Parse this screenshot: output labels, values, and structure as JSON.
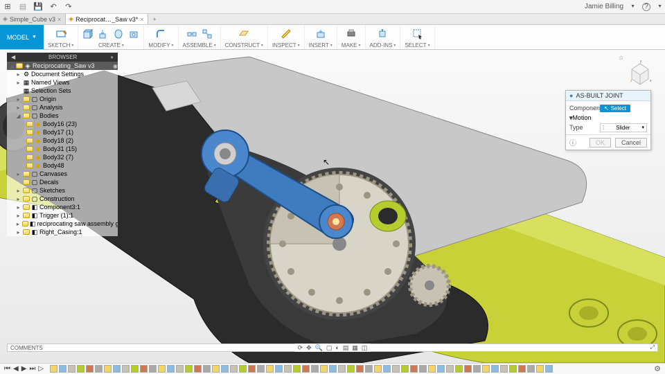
{
  "titlebar": {
    "user": "Jamie Billing",
    "help_icon": "?"
  },
  "doctabs": {
    "tabs": [
      {
        "icon": "◆",
        "label": "Simple_Cube v3",
        "active": false
      },
      {
        "icon": "◆",
        "label": "Reciprocat…_Saw v3*",
        "active": true
      }
    ]
  },
  "ribbon": {
    "model_label": "MODEL",
    "groups": [
      {
        "label": "SKETCH"
      },
      {
        "label": "CREATE"
      },
      {
        "label": "MODIFY"
      },
      {
        "label": "ASSEMBLE"
      },
      {
        "label": "CONSTRUCT"
      },
      {
        "label": "INSPECT"
      },
      {
        "label": "INSERT"
      },
      {
        "label": "MAKE"
      },
      {
        "label": "ADD-INS"
      },
      {
        "label": "SELECT"
      }
    ]
  },
  "browser": {
    "title": "BROWSER",
    "root": "Reciprocating_Saw v3",
    "nodes": [
      {
        "twist": "▸",
        "icon": "⚙",
        "label": "Document Settings"
      },
      {
        "twist": "▸",
        "icon": "▦",
        "label": "Named Views"
      },
      {
        "twist": "",
        "icon": "▦",
        "label": "Selection Sets"
      },
      {
        "twist": "▸",
        "bulb": true,
        "icon": "▢",
        "label": "Origin"
      },
      {
        "twist": "▸",
        "bulb": true,
        "icon": "▢",
        "label": "Analysis"
      },
      {
        "twist": "◢",
        "bulb": true,
        "icon": "▢",
        "label": "Bodies"
      }
    ],
    "bodies": [
      {
        "label": "Body16 (23)"
      },
      {
        "label": "Body17 (1)"
      },
      {
        "label": "Body18 (2)"
      },
      {
        "label": "Body31 (15)"
      },
      {
        "label": "Body32 (7)"
      },
      {
        "label": "Body48"
      }
    ],
    "tail": [
      {
        "twist": "▸",
        "bulb": true,
        "icon": "▢",
        "label": "Canvases"
      },
      {
        "twist": "",
        "bulb": true,
        "icon": "▢",
        "label": "Decals"
      },
      {
        "twist": "▸",
        "bulb": true,
        "icon": "▢",
        "label": "Sketches"
      },
      {
        "twist": "▸",
        "bulb": true,
        "icon": "▢",
        "label": "Construction"
      },
      {
        "twist": "▸",
        "bulb": true,
        "icon": "◧",
        "label": "Component3:1"
      },
      {
        "twist": "▸",
        "bulb": true,
        "icon": "◧",
        "label": "Trigger (1):1"
      },
      {
        "twist": "▸",
        "bulb": true,
        "icon": "◧",
        "label": "reciprocating saw assembly gut…"
      },
      {
        "twist": "▸",
        "bulb": true,
        "icon": "◧",
        "label": "Right_Casing:1"
      }
    ]
  },
  "dialog": {
    "title": "AS-BUILT JOINT",
    "components_label": "Components",
    "select_label": "Select",
    "motion_label": "Motion",
    "type_label": "Type",
    "type_value": "Slider",
    "ok_label": "OK",
    "cancel_label": "Cancel"
  },
  "comments": {
    "label": "COMMENTS"
  },
  "timeline": {
    "ops_count": 56
  }
}
